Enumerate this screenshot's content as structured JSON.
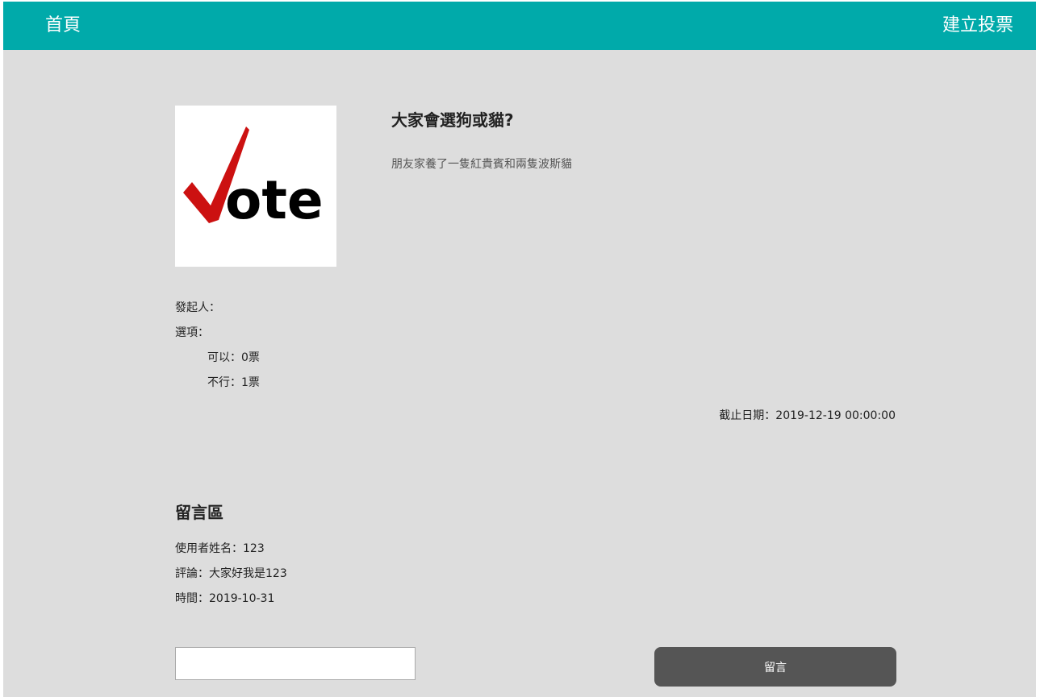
{
  "nav": {
    "home_label": "首頁",
    "create_label": "建立投票"
  },
  "poll": {
    "image_alt": "Vote",
    "image_text": "ote",
    "title": "大家會選狗或貓?",
    "description": "朋友家養了一隻紅貴賓和兩隻波斯貓",
    "initiator_label": "發起人：",
    "options_label": "選項：",
    "options": [
      {
        "label": "可以：0票"
      },
      {
        "label": "不行：1票"
      }
    ],
    "deadline_label": "截止日期：2019-12-19 00:00:00"
  },
  "comments": {
    "title": "留言區",
    "items": [
      {
        "user": "使用者姓名：123",
        "text": "評論：大家好我是123",
        "time": "時間：2019-10-31"
      }
    ],
    "input_value": "",
    "submit_label": "留言"
  },
  "colors": {
    "navbar": "#00aaaa",
    "page_background": "#dddddd",
    "button": "#555555",
    "vote_check": "#cc1111"
  }
}
